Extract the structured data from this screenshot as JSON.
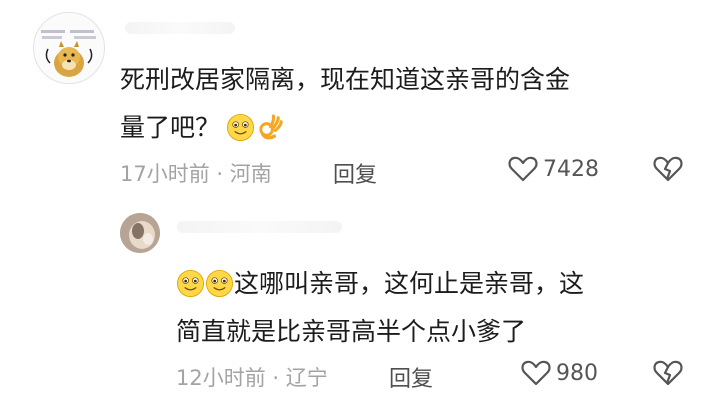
{
  "comments": [
    {
      "text_line1": "死刑改居家隔离，现在知道这亲哥的含金",
      "text_line2": "量了吧？",
      "time": "17小时前",
      "separator": "·",
      "location": "河南",
      "reply_label": "回复",
      "like_count": "7428",
      "avatar_icon": "doge-avatar-icon"
    },
    {
      "text_line1": "这哪叫亲哥，这何止是亲哥，这",
      "text_line2": "简直就是比亲哥高半个点小爹了",
      "time": "12小时前",
      "separator": "·",
      "location": "辽宁",
      "reply_label": "回复",
      "like_count": "980",
      "avatar_icon": "user-avatar-icon"
    }
  ],
  "colors": {
    "text": "#1c1c1c",
    "meta": "#a3a3a3",
    "icon": "#555555"
  }
}
